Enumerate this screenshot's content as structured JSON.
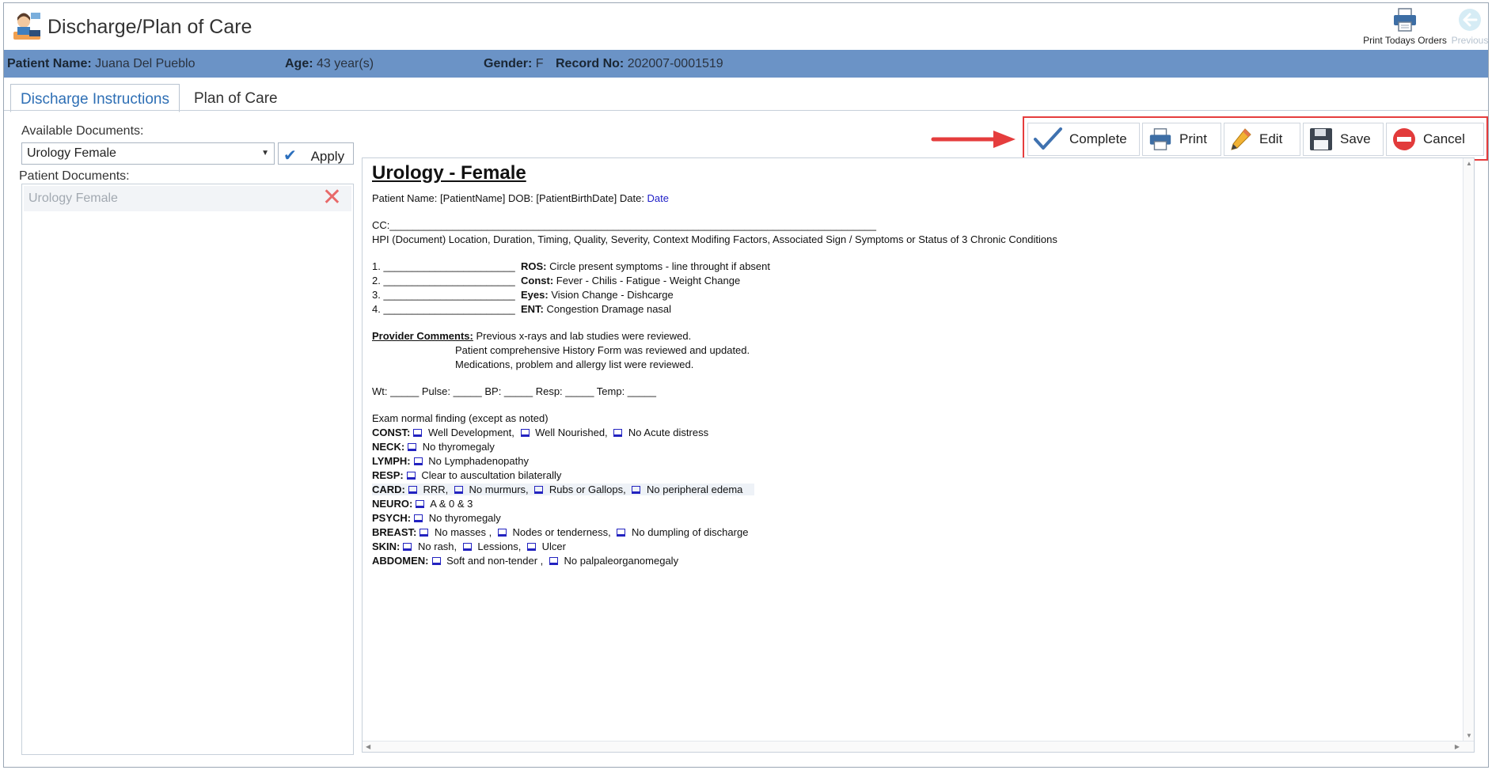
{
  "app": {
    "title": "Discharge/Plan of Care",
    "print_orders_label": "Print Todays Orders",
    "previous_label": "Previous"
  },
  "patient": {
    "name_label": "Patient Name:",
    "name": "Juana Del Pueblo",
    "age_label": "Age:",
    "age": "43 year(s)",
    "gender_label": "Gender:",
    "gender": "F",
    "record_label": "Record No:",
    "record": "202007-0001519"
  },
  "tabs": [
    {
      "label": "Discharge Instructions",
      "active": true
    },
    {
      "label": "Plan of Care",
      "active": false
    }
  ],
  "left_panel": {
    "available_label": "Available Documents:",
    "selected_document": "Urology Female",
    "apply_label": "Apply",
    "patient_docs_label": "Patient Documents:",
    "patient_docs": [
      "Urology Female"
    ]
  },
  "toolbar": {
    "complete": "Complete",
    "print": "Print",
    "edit": "Edit",
    "save": "Save",
    "cancel": "Cancel"
  },
  "document": {
    "title": "Urology - Female",
    "header_text": "Patient Name: [PatientName] DOB: [PatientBirthDate] Date: ",
    "header_date": "Date",
    "cc": "CC:_____________________________________________________________________________________",
    "hpi": "HPI (Document) Location, Duration, Timing, Quality, Severity, Context Modifing Factors, Associated Sign / Symptoms or Status of 3 Chronic Conditions",
    "numbered": [
      {
        "num": "1. _______________________",
        "key": "ROS:",
        "text": "Circle present symptoms - line throught if absent"
      },
      {
        "num": "2. _______________________",
        "key": "Const:",
        "text": "Fever - Chilis - Fatigue - Weight Change"
      },
      {
        "num": "3. _______________________",
        "key": "Eyes:",
        "text": "Vision Change - Dishcarge"
      },
      {
        "num": "4. _______________________",
        "key": "ENT:",
        "text": "Congestion Dramage nasal"
      }
    ],
    "provider_label": "Provider Comments:",
    "provider_lines": [
      "Previous x-rays and lab studies were reviewed.",
      "Patient comprehensive History Form was reviewed and updated.",
      "Medications, problem and allergy list were reviewed."
    ],
    "vitals": "Wt: _____ Pulse: _____ BP: _____ Resp: _____ Temp: _____",
    "exam_intro": "Exam normal finding (except as noted)",
    "exam": [
      {
        "key": "CONST:",
        "items": [
          "Well Development,",
          "Well Nourished,",
          "No Acute distress"
        ]
      },
      {
        "key": "NECK:",
        "items": [
          "No thyromegaly"
        ]
      },
      {
        "key": "LYMPH:",
        "items": [
          "No Lymphadenopathy"
        ]
      },
      {
        "key": "RESP:",
        "items": [
          "Clear to auscultation bilaterally"
        ]
      },
      {
        "key": "CARD:",
        "items": [
          "RRR,",
          "No murmurs,",
          "Rubs or Gallops,",
          "No peripheral edema"
        ]
      },
      {
        "key": "NEURO:",
        "items": [
          "A & 0 & 3"
        ]
      },
      {
        "key": "PSYCH:",
        "items": [
          "No thyromegaly"
        ]
      },
      {
        "key": "BREAST:",
        "items": [
          "No masses ,",
          "Nodes or tenderness,",
          "No dumpling of discharge"
        ]
      },
      {
        "key": "SKIN:",
        "items": [
          "No rash,",
          "Lessions,",
          "Ulcer"
        ]
      },
      {
        "key": "ABDOMEN:",
        "items": [
          "Soft and non-tender ,",
          "No palpaleorganomegaly"
        ]
      }
    ]
  },
  "colors": {
    "patient_bar": "#6b93c6",
    "accent_blue": "#2e6fb5",
    "highlight_red": "#e53d3d"
  }
}
